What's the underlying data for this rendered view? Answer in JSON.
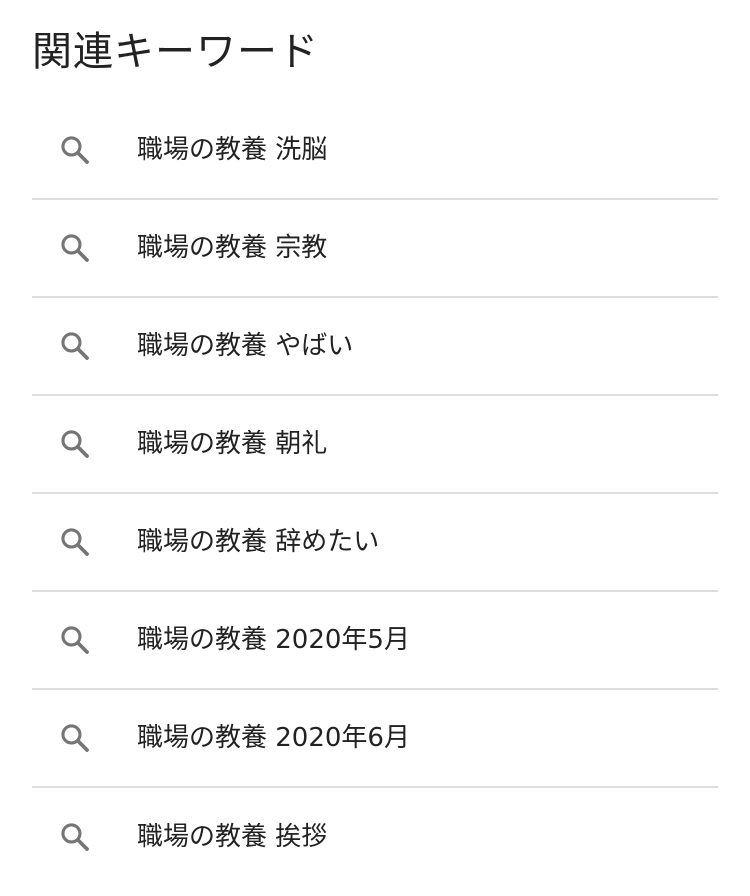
{
  "section": {
    "title": "関連キーワード"
  },
  "keywords": [
    {
      "label": "職場の教養 洗脳",
      "icon": "search-icon"
    },
    {
      "label": "職場の教養 宗教",
      "icon": "search-icon"
    },
    {
      "label": "職場の教養 やばい",
      "icon": "search-icon"
    },
    {
      "label": "職場の教養 朝礼",
      "icon": "search-icon"
    },
    {
      "label": "職場の教養 辞めたい",
      "icon": "search-icon"
    },
    {
      "label": "職場の教養 2020年5月",
      "icon": "search-icon"
    },
    {
      "label": "職場の教養 2020年6月",
      "icon": "search-icon"
    },
    {
      "label": "職場の教養 挨拶",
      "icon": "search-icon"
    }
  ],
  "colors": {
    "text": "#222222",
    "icon": "#757575",
    "divider": "#dcdcdc",
    "background": "#ffffff"
  }
}
